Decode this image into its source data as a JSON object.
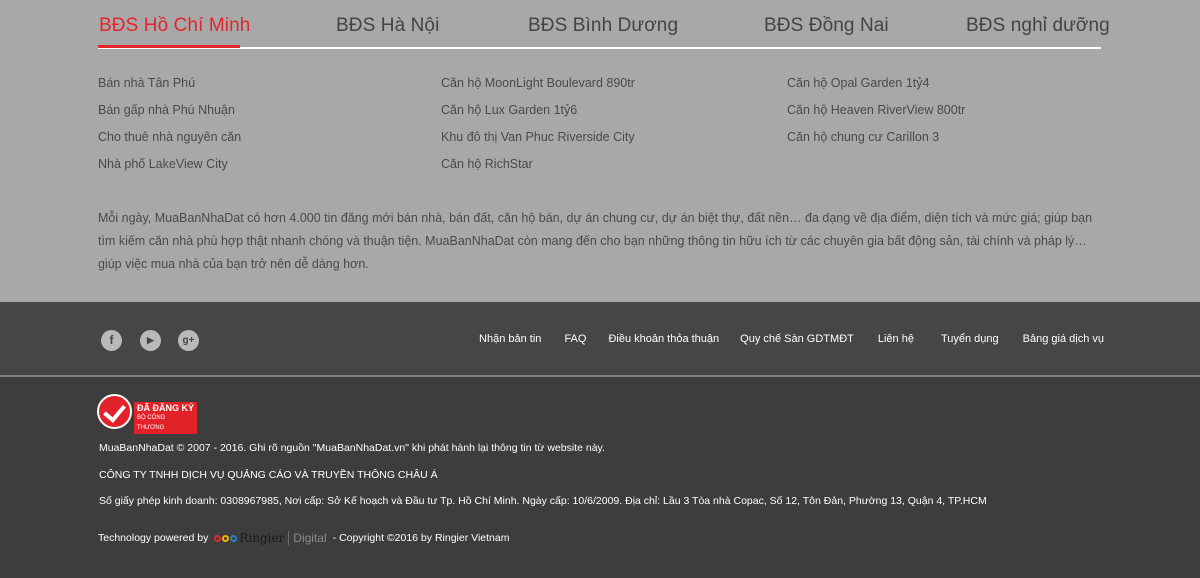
{
  "tabs": [
    {
      "label": "BĐS Hồ Chí Minh",
      "active": true
    },
    {
      "label": "BĐS Hà Nội",
      "active": false
    },
    {
      "label": "BĐS Bình Dương",
      "active": false
    },
    {
      "label": "BĐS Đồng Nai",
      "active": false
    },
    {
      "label": "BĐS nghỉ dưỡng",
      "active": false
    }
  ],
  "links": {
    "col1": [
      "Bán nhà Tân Phú",
      "Bán gấp nhà Phú Nhuận",
      "Cho thuê nhà nguyên căn",
      "Nhà phố LakeView City"
    ],
    "col2": [
      "Căn hộ MoonLight Boulevard 890tr",
      "Căn hộ Lux Garden 1tỷ6",
      "Khu đô thị Van Phuc Riverside City",
      "Căn hộ RichStar"
    ],
    "col3": [
      "Căn hộ Opal Garden 1tỷ4",
      "Căn hộ Heaven RiverView 800tr",
      "Căn hộ chung cư Carillon 3"
    ]
  },
  "description": "Mỗi ngày, MuaBanNhaDat có hơn 4.000 tin đăng mới bán nhà, bán đất, căn hộ bán, dự án chung cư, dự án biệt thự, đất nền… đa dạng về địa điểm, diện tích và mức giá; giúp bạn tìm kiếm căn nhà phù hợp thật nhanh chóng và thuận tiện. MuaBanNhaDat còn mang đến cho bạn những thông tin hữu ích từ các chuyên gia bất động sản, tài chính và pháp lý… giúp việc mua nhà của bạn trở nên dễ dàng hơn.",
  "social": [
    {
      "icon": "facebook-icon",
      "glyph": "f"
    },
    {
      "icon": "youtube-icon",
      "glyph": "▶"
    },
    {
      "icon": "google-plus-icon",
      "glyph": "g+"
    }
  ],
  "footer_nav": [
    "Nhận bản tin",
    "FAQ",
    "Điều khoản thỏa thuận",
    "Quy chế Sàn GDTMĐT",
    "Liên hệ",
    "Tuyển dụng",
    "Bảng giá dịch vụ"
  ],
  "badge": {
    "line1": "ĐÃ ĐĂNG KÝ",
    "line2": "BỘ CÔNG THƯƠNG"
  },
  "footer": {
    "copyright": "MuaBanNhaDat © 2007 - 2016. Ghi rõ nguồn \"MuaBanNhaDat.vn\" khi phát hành lại thông tin từ website này.",
    "company": "CÔNG TY TNHH DỊCH VỤ QUẢNG CÁO VÀ TRUYỀN THÔNG CHÂU Á",
    "license": "Số giấy phép kinh doanh: 0308967985, Nơi cấp: Sở Kế hoạch và Đầu tư Tp. Hồ Chí Minh. Ngày cấp: 10/6/2009. Địa chỉ: Lầu 3 Tòa nhà Copac, Số 12, Tôn Đản, Phường 13, Quận 4, TP.HCM",
    "powered_label": "Technology powered by",
    "ringier": "Ringier",
    "digital": "Digital",
    "ringier_copyright": "- Copyright ©2016 by Ringier Vietnam"
  },
  "colors": {
    "accent": "#e3262b",
    "top_bg": "#a8a8a8",
    "footer_bg": "#3d3d3d"
  }
}
